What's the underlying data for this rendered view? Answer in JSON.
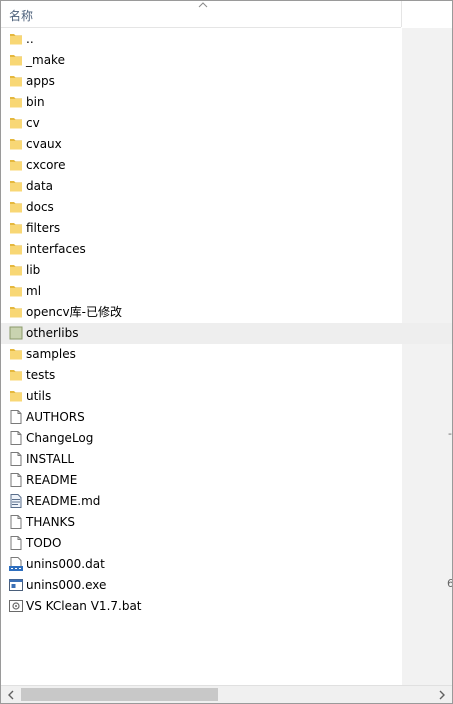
{
  "header": {
    "name_column": "名称"
  },
  "items": [
    {
      "label": "..",
      "icon": "folder-icon"
    },
    {
      "label": "_make",
      "icon": "folder-icon"
    },
    {
      "label": "apps",
      "icon": "folder-icon"
    },
    {
      "label": "bin",
      "icon": "folder-icon"
    },
    {
      "label": "cv",
      "icon": "folder-icon"
    },
    {
      "label": "cvaux",
      "icon": "folder-icon"
    },
    {
      "label": "cxcore",
      "icon": "folder-icon"
    },
    {
      "label": "data",
      "icon": "folder-icon"
    },
    {
      "label": "docs",
      "icon": "folder-icon"
    },
    {
      "label": "filters",
      "icon": "folder-icon"
    },
    {
      "label": "interfaces",
      "icon": "folder-icon"
    },
    {
      "label": "lib",
      "icon": "folder-icon"
    },
    {
      "label": "ml",
      "icon": "folder-icon"
    },
    {
      "label": "opencv库-已修改",
      "icon": "folder-icon"
    },
    {
      "label": "otherlibs",
      "icon": "folder-icon",
      "hover": true
    },
    {
      "label": "samples",
      "icon": "folder-icon"
    },
    {
      "label": "tests",
      "icon": "folder-icon"
    },
    {
      "label": "utils",
      "icon": "folder-icon"
    },
    {
      "label": "AUTHORS",
      "icon": "file-icon"
    },
    {
      "label": "ChangeLog",
      "icon": "file-icon"
    },
    {
      "label": "INSTALL",
      "icon": "file-icon"
    },
    {
      "label": "README",
      "icon": "file-icon"
    },
    {
      "label": "README.md",
      "icon": "markdown-file-icon"
    },
    {
      "label": "THANKS",
      "icon": "file-icon"
    },
    {
      "label": "TODO",
      "icon": "file-icon"
    },
    {
      "label": "unins000.dat",
      "icon": "data-file-icon"
    },
    {
      "label": "unins000.exe",
      "icon": "exe-file-icon"
    },
    {
      "label": "VS KClean V1.7.bat",
      "icon": "batch-file-icon"
    }
  ],
  "right_pane": {
    "mark_1": "-",
    "mark_2": "6"
  },
  "colors": {
    "folder": "#f8d775",
    "folder_dark": "#e5b83e",
    "hover": "#eeeeee",
    "header_text": "#4c607a"
  }
}
